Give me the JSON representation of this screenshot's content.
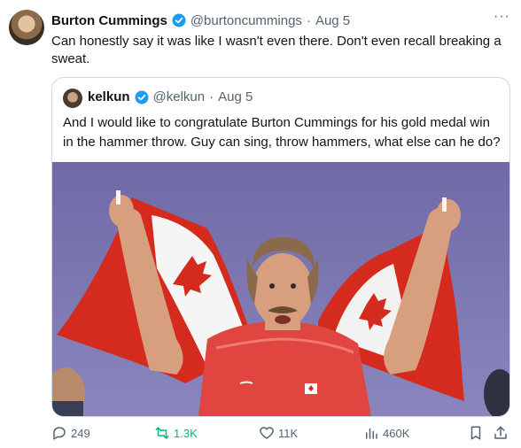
{
  "tweet": {
    "author_name": "Burton Cummings",
    "author_handle": "@burtoncummings",
    "separator": "·",
    "date": "Aug 5",
    "more": "···",
    "text": "Can honestly say it was like I wasn't even there. Don't even recall breaking a sweat."
  },
  "quoted": {
    "author_name": "kelkun",
    "author_handle": "@kelkun",
    "separator": "·",
    "date": "Aug 5",
    "text": "And I would like to congratulate Burton Cummings for his gold medal win in the hammer throw. Guy can sing, throw hammers, what else can he do?"
  },
  "actions": {
    "replies": "249",
    "reposts": "1.3K",
    "likes": "11K",
    "views": "460K"
  },
  "colors": {
    "verified": "#1d9bf0",
    "repost": "#00ba7c",
    "muted": "#536471",
    "flag_red": "#d52b1e"
  }
}
